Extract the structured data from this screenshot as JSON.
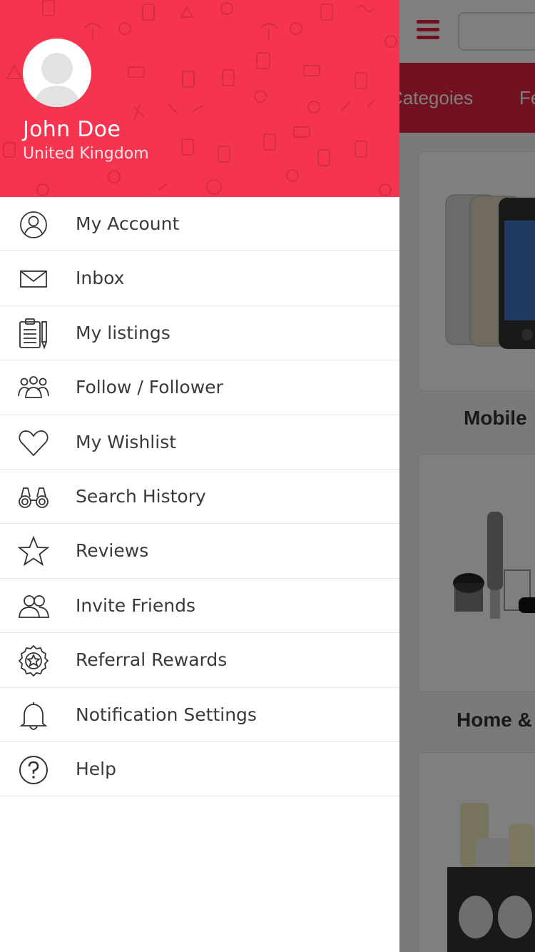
{
  "background_app": {
    "tabs": [
      "Categoies",
      "Fe"
    ],
    "products": [
      {
        "caption": "Mobile"
      },
      {
        "caption": "Home &"
      },
      {
        "caption": ""
      }
    ]
  },
  "drawer": {
    "user": {
      "name": "John Doe",
      "country": "United Kingdom"
    },
    "menu": [
      {
        "label": "My Account",
        "icon": "user-circle-icon"
      },
      {
        "label": "Inbox",
        "icon": "envelope-icon"
      },
      {
        "label": "My listings",
        "icon": "clipboard-list-icon"
      },
      {
        "label": "Follow / Follower",
        "icon": "group-icon"
      },
      {
        "label": "My Wishlist",
        "icon": "heart-icon"
      },
      {
        "label": "Search History",
        "icon": "binoculars-icon"
      },
      {
        "label": "Reviews",
        "icon": "star-icon"
      },
      {
        "label": "Invite Friends",
        "icon": "users-icon"
      },
      {
        "label": "Referral Rewards",
        "icon": "badge-icon"
      },
      {
        "label": "Notification Settings",
        "icon": "bell-icon"
      },
      {
        "label": "Help",
        "icon": "question-circle-icon"
      }
    ]
  },
  "colors": {
    "accent": "#f5344f",
    "background_accent": "#e5233f",
    "text": "#3a3a3a"
  }
}
